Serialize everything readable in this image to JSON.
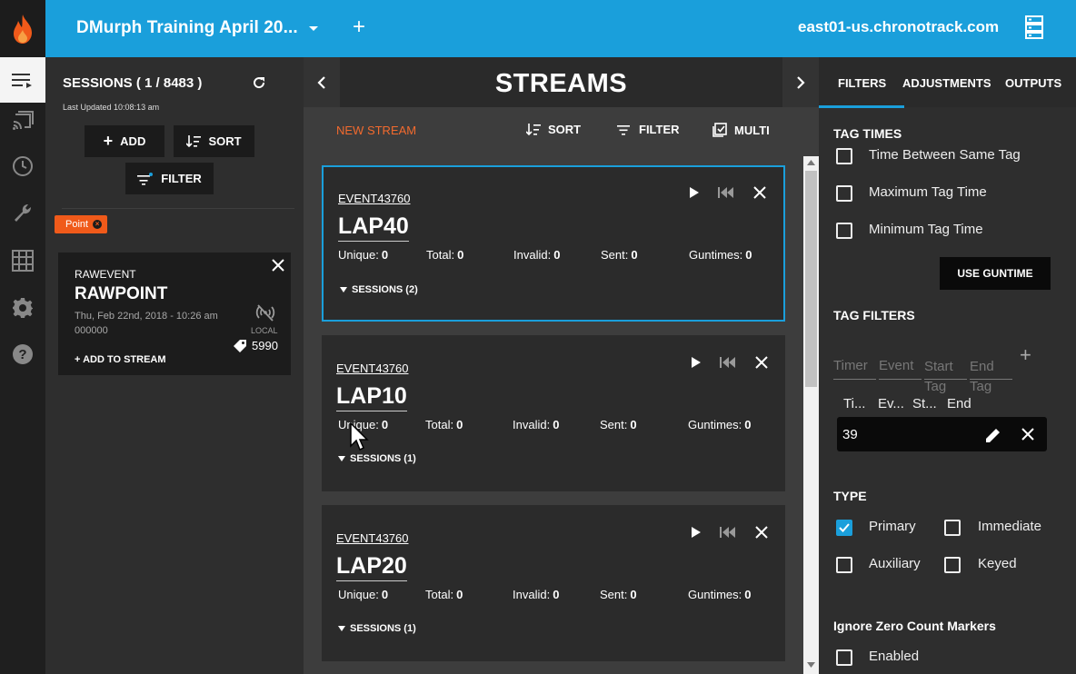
{
  "header": {
    "event_title": "DMurph Training April 20...",
    "server": "east01-us.chronotrack.com"
  },
  "nav": {
    "items": [
      "list-icon",
      "cast-icon",
      "clock-icon",
      "wrench-icon",
      "grid-icon",
      "gear-icon",
      "help-icon"
    ]
  },
  "sessions": {
    "title": "SESSIONS ( 1 / 8483 )",
    "last_updated": "Last Updated 10:08:13 am",
    "add_label": "ADD",
    "sort_label": "SORT",
    "filter_label": "FILTER",
    "chip_label": "Point",
    "card": {
      "type": "RAWEVENT",
      "name": "RAWPOINT",
      "date": "Thu, Feb 22nd, 2018 - 10:26 am",
      "number": "000000",
      "local": "LOCAL",
      "count": "5990",
      "add_to_stream": "+ ADD TO STREAM"
    }
  },
  "streams": {
    "title": "STREAMS",
    "new_stream": "NEW STREAM",
    "sort_label": "SORT",
    "filter_label": "FILTER",
    "multi_label": "MULTI",
    "stat_labels": [
      "Unique:",
      "Total:",
      "Invalid:",
      "Sent:",
      "Guntimes:"
    ],
    "cards": [
      {
        "event": "EVENT43760",
        "lap": "LAP40",
        "stats": [
          "0",
          "0",
          "0",
          "0",
          "0"
        ],
        "sessions": "SESSIONS (2)"
      },
      {
        "event": "EVENT43760",
        "lap": "LAP10",
        "stats": [
          "0",
          "0",
          "0",
          "0",
          "0"
        ],
        "sessions": "SESSIONS (1)"
      },
      {
        "event": "EVENT43760",
        "lap": "LAP20",
        "stats": [
          "0",
          "0",
          "0",
          "0",
          "0"
        ],
        "sessions": "SESSIONS (1)"
      }
    ]
  },
  "filters": {
    "tabs": [
      "FILTERS",
      "ADJUSTMENTS",
      "OUTPUTS"
    ],
    "tag_times_title": "TAG TIMES",
    "tag_times": [
      "Time Between Same Tag",
      "Maximum Tag Time",
      "Minimum Tag Time"
    ],
    "use_guntime": "USE GUNTIME",
    "tag_filters_title": "TAG FILTERS",
    "tf_placeholders": [
      "Timer",
      "Event",
      "Start Tag",
      "End Tag"
    ],
    "tf_headers": [
      "Ti...",
      "Ev...",
      "St...",
      "End"
    ],
    "tf_row_value": "39",
    "type_title": "TYPE",
    "types": [
      {
        "label": "Primary",
        "checked": true
      },
      {
        "label": "Immediate",
        "checked": false
      },
      {
        "label": "Auxiliary",
        "checked": false
      },
      {
        "label": "Keyed",
        "checked": false
      }
    ],
    "zero_title": "Ignore Zero Count Markers",
    "zero_enabled": "Enabled"
  },
  "colors": {
    "accent": "#1a9fdb",
    "orange": "#f05a1a"
  }
}
